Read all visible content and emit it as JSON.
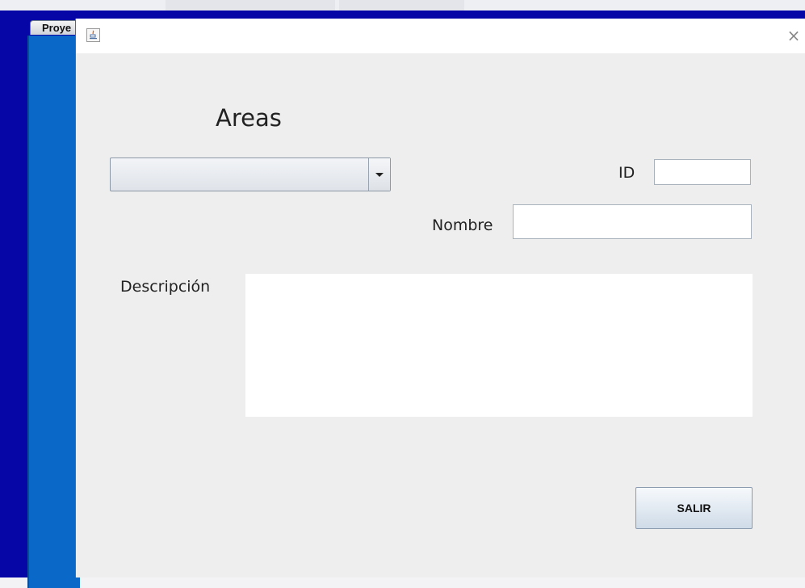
{
  "parent_window": {
    "tab_label": "Proye"
  },
  "dialog": {
    "title_icon": "java-icon",
    "close_icon": "close-icon",
    "close_glyph": "×",
    "heading": "Areas",
    "areas_combo": {
      "selected": "",
      "arrow_icon": "chevron-down-icon"
    },
    "fields": {
      "id_label": "ID",
      "id_value": "",
      "nombre_label": "Nombre",
      "nombre_value": "",
      "descripcion_label": "Descripción",
      "descripcion_value": ""
    },
    "buttons": {
      "salir_label": "SALIR"
    }
  },
  "colors": {
    "parent_frame": "#0606a6",
    "parent_pane": "#0968c8",
    "dialog_bg": "#eeeeee"
  }
}
